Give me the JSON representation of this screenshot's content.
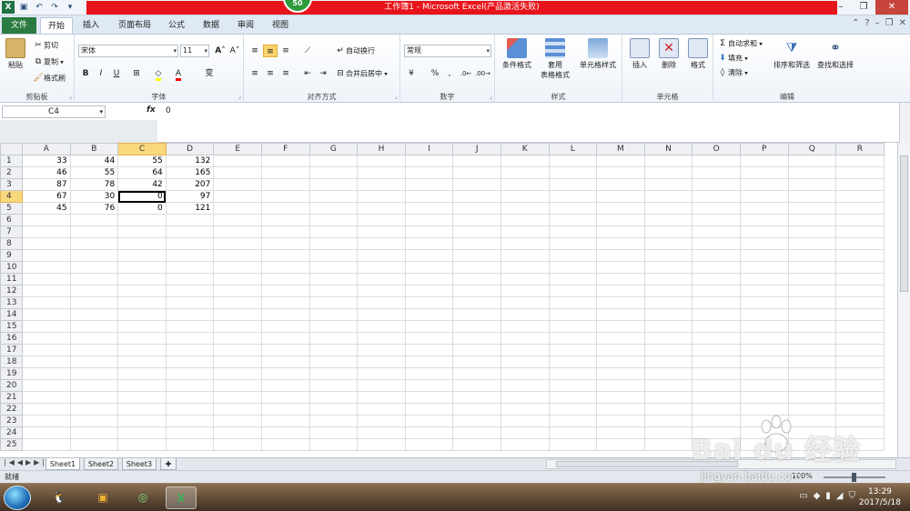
{
  "title_bar": {
    "title": "工作簿1 - Microsoft Excel(产品激活失败)",
    "badge": "50",
    "quick_access": [
      "excel-logo",
      "save-icon",
      "undo-icon",
      "redo-icon",
      "customize-icon"
    ]
  },
  "ribbon_tabs": {
    "file": "文件",
    "items": [
      "开始",
      "插入",
      "页面布局",
      "公式",
      "数据",
      "审阅",
      "视图"
    ],
    "active": "开始"
  },
  "clipboard": {
    "paste": "粘贴",
    "cut": "剪切",
    "copy": "复制",
    "format_painter": "格式刷",
    "label": "剪贴板"
  },
  "font": {
    "name": "宋体",
    "size": "11",
    "bold": "B",
    "italic": "I",
    "underline": "U",
    "label": "字体",
    "fill_color": "#ffff00",
    "font_color": "#ff0000"
  },
  "alignment": {
    "wrap": "自动换行",
    "merge": "合并后居中",
    "label": "对齐方式"
  },
  "number": {
    "format": "常规",
    "percent": "%",
    "comma": ",",
    "label": "数字"
  },
  "styles": {
    "conditional": "条件格式",
    "table_format_1": "套用",
    "table_format_2": "表格格式",
    "cell_styles": "单元格样式",
    "label": "样式"
  },
  "cells": {
    "insert": "插入",
    "delete": "删除",
    "format": "格式",
    "label": "单元格"
  },
  "editing": {
    "autosum": "自动求和",
    "fill": "填充",
    "clear": "清除",
    "sort": "排序和筛选",
    "find": "查找和选择",
    "label": "编辑"
  },
  "formula_bar": {
    "name_box": "C4",
    "fx": "fx",
    "content": "0"
  },
  "sheet": {
    "columns": [
      "A",
      "B",
      "C",
      "D",
      "E",
      "F",
      "G",
      "H",
      "I",
      "J",
      "K",
      "L",
      "M",
      "N",
      "O",
      "P",
      "Q",
      "R"
    ],
    "active_column": "C",
    "active_row": 4,
    "rows": [
      [
        "33",
        "44",
        "55",
        "132"
      ],
      [
        "46",
        "55",
        "64",
        "165"
      ],
      [
        "87",
        "78",
        "42",
        "207"
      ],
      [
        "67",
        "30",
        "0",
        "97"
      ],
      [
        "45",
        "76",
        "0",
        "121"
      ]
    ],
    "row_count": 25
  },
  "sheet_tabs": [
    "Sheet1",
    "Sheet2",
    "Sheet3"
  ],
  "active_sheet": "Sheet1",
  "status": {
    "text": "就绪",
    "zoom": "100%"
  },
  "taskbar": {
    "time": "13:29",
    "date": "2017/5/18"
  },
  "watermark": {
    "main": "Bai du 经验",
    "sub": "jingyan.baidu.com"
  }
}
